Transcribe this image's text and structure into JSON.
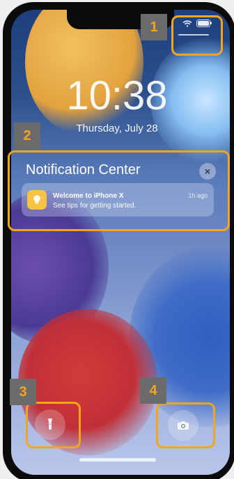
{
  "lock_screen": {
    "time": "10:38",
    "date": "Thursday, July 28"
  },
  "status_bar": {
    "icons": [
      "wifi-icon",
      "battery-icon"
    ],
    "battery_level": 1.0
  },
  "notification_center": {
    "title": "Notification Center",
    "close_icon": "×",
    "notification": {
      "app_icon": "lightbulb-icon",
      "title": "Welcome to iPhone X",
      "body": "See tips for getting started.",
      "time": "1h ago"
    }
  },
  "quick_actions": {
    "flashlight": "flashlight-icon",
    "camera": "camera-icon"
  },
  "annotations": [
    "1",
    "2",
    "3",
    "4"
  ],
  "colors": {
    "annotation_stroke": "#f4a51e",
    "annotation_label_bg": "#6b6b6b",
    "app_icon_bg": "#f6c343"
  }
}
